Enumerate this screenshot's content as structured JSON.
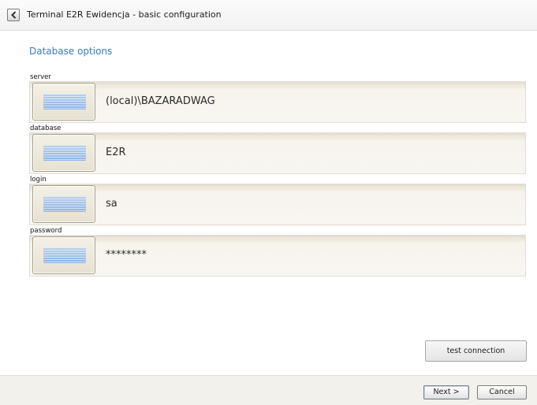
{
  "window": {
    "title": "Terminal E2R Ewidencja - basic configuration",
    "back_icon": "chevron-left-icon"
  },
  "section_title": "Database options",
  "fields": [
    {
      "label": "server",
      "value": "(local)\\BAZARADWAG"
    },
    {
      "label": "database",
      "value": "E2R"
    },
    {
      "label": "login",
      "value": "sa"
    },
    {
      "label": "password",
      "value": "********"
    }
  ],
  "buttons": {
    "test_connection": "test connection",
    "next": "Next >",
    "cancel": "Cancel"
  },
  "colors": {
    "section_title": "#3a7bbd",
    "keyboard_icon": "#9dbde8"
  }
}
